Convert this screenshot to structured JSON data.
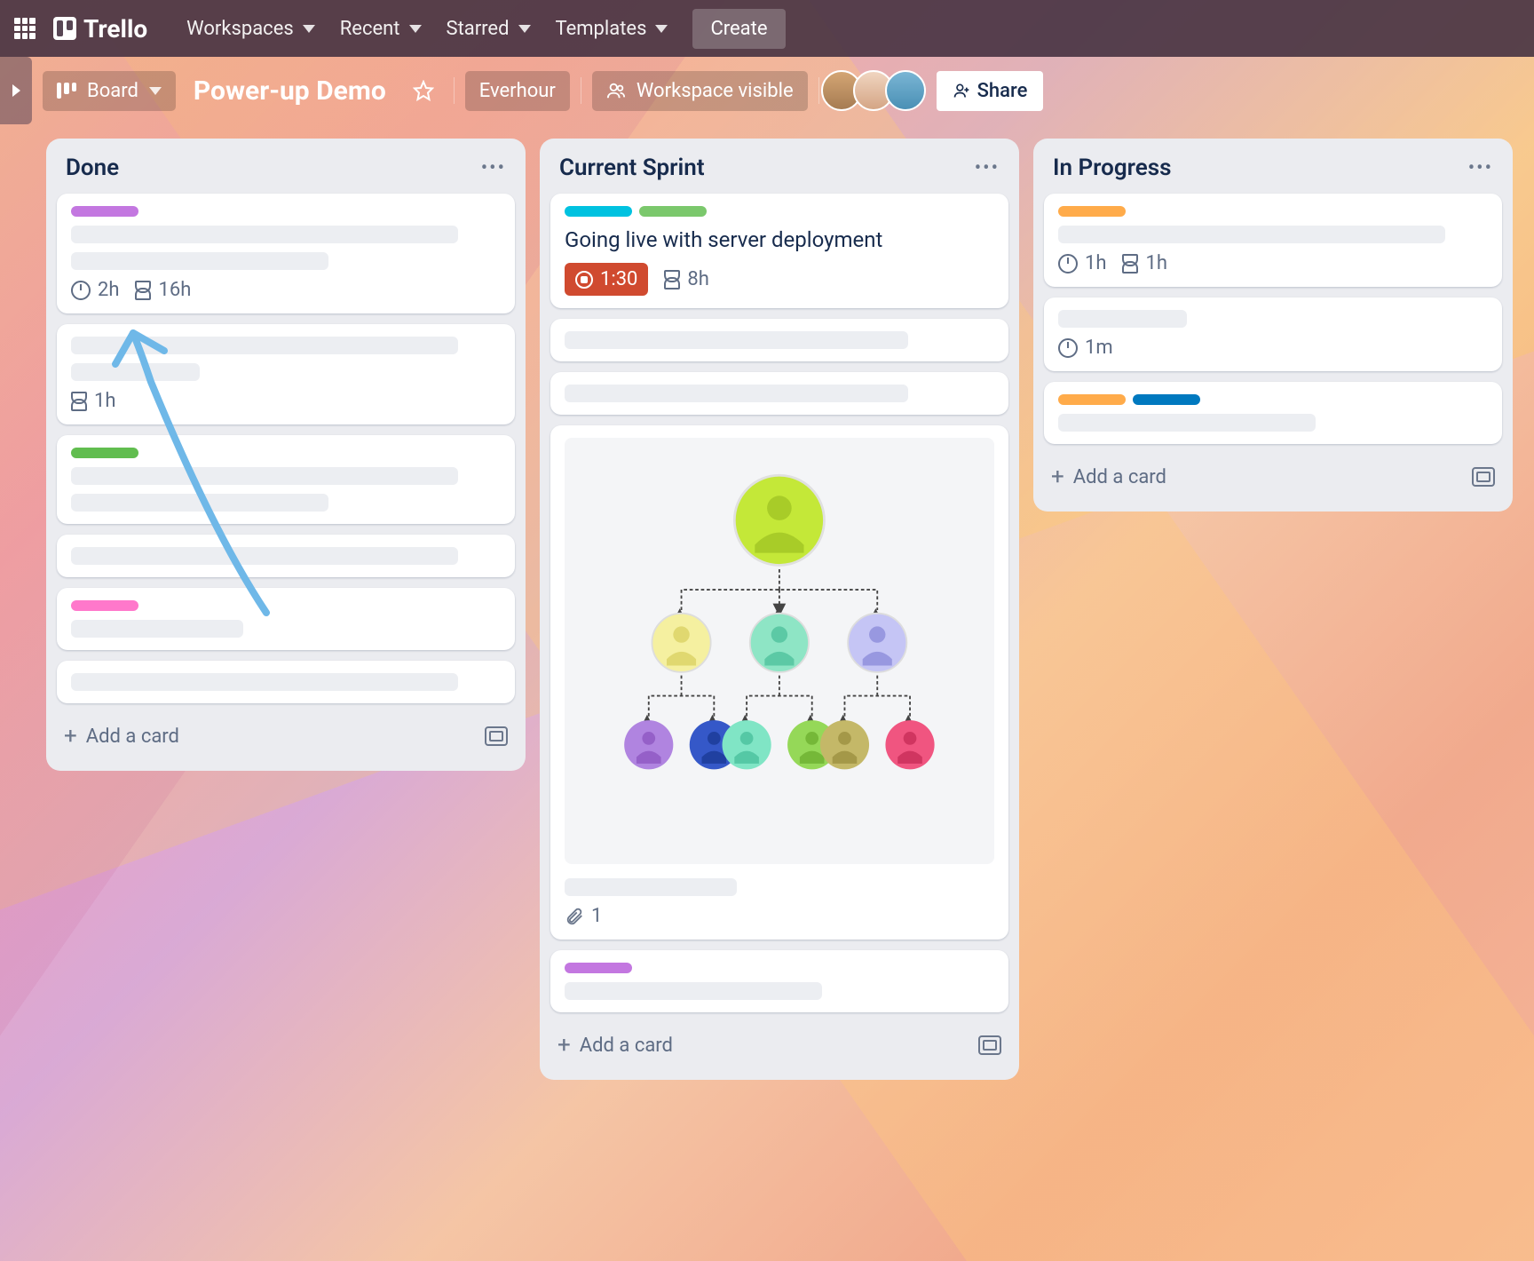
{
  "topbar": {
    "brand": "Trello",
    "nav": {
      "workspaces": "Workspaces",
      "recent": "Recent",
      "starred": "Starred",
      "templates": "Templates"
    },
    "create": "Create"
  },
  "boardbar": {
    "view_label": "Board",
    "title": "Power-up Demo",
    "powerup": "Everhour",
    "visibility": "Workspace visible",
    "share": "Share"
  },
  "lists": [
    {
      "title": "Done",
      "add_label": "Add a card",
      "cards": [
        {
          "labels": [
            "purple"
          ],
          "placeholder_lines": [
            "w90",
            "w60"
          ],
          "badges": [
            {
              "type": "clock",
              "text": "2h"
            },
            {
              "type": "hourglass",
              "text": "16h"
            }
          ]
        },
        {
          "labels": [],
          "placeholder_lines": [
            "w90",
            "w30"
          ],
          "badges": [
            {
              "type": "hourglass",
              "text": "1h"
            }
          ]
        },
        {
          "labels": [
            "green"
          ],
          "placeholder_lines": [
            "w90",
            "w60"
          ],
          "badges": []
        },
        {
          "labels": [],
          "placeholder_lines": [
            "w90"
          ],
          "badges": []
        },
        {
          "labels": [
            "pink"
          ],
          "placeholder_lines": [
            "w40"
          ],
          "badges": []
        },
        {
          "labels": [],
          "placeholder_lines": [
            "w90"
          ],
          "badges": []
        }
      ]
    },
    {
      "title": "Current Sprint",
      "add_label": "Add a card",
      "cards": [
        {
          "labels": [
            "cyan",
            "lime"
          ],
          "title": "Going live with server deployment",
          "badges": [
            {
              "type": "timer",
              "text": "1:30"
            },
            {
              "type": "hourglass",
              "text": "8h"
            }
          ]
        },
        {
          "labels": [],
          "placeholder_lines": [
            "w80"
          ],
          "badges": []
        },
        {
          "labels": [],
          "placeholder_lines": [
            "w80"
          ],
          "badges": []
        },
        {
          "cover": "org-chart",
          "placeholder_lines": [
            "w40"
          ],
          "badges": [
            {
              "type": "attach",
              "text": "1"
            }
          ]
        },
        {
          "labels": [
            "purple"
          ],
          "placeholder_lines": [
            "w60"
          ],
          "badges": []
        }
      ]
    },
    {
      "title": "In Progress",
      "add_label": "Add a card",
      "cards": [
        {
          "labels": [
            "orange"
          ],
          "placeholder_lines": [
            "w90"
          ],
          "badges": [
            {
              "type": "clock",
              "text": "1h"
            },
            {
              "type": "hourglass",
              "text": "1h"
            }
          ]
        },
        {
          "labels": [],
          "placeholder_lines": [
            "w30"
          ],
          "badges": [
            {
              "type": "clock",
              "text": "1m"
            }
          ]
        },
        {
          "labels": [
            "orange",
            "blue"
          ],
          "placeholder_lines": [
            "w60"
          ],
          "badges": []
        }
      ]
    }
  ]
}
